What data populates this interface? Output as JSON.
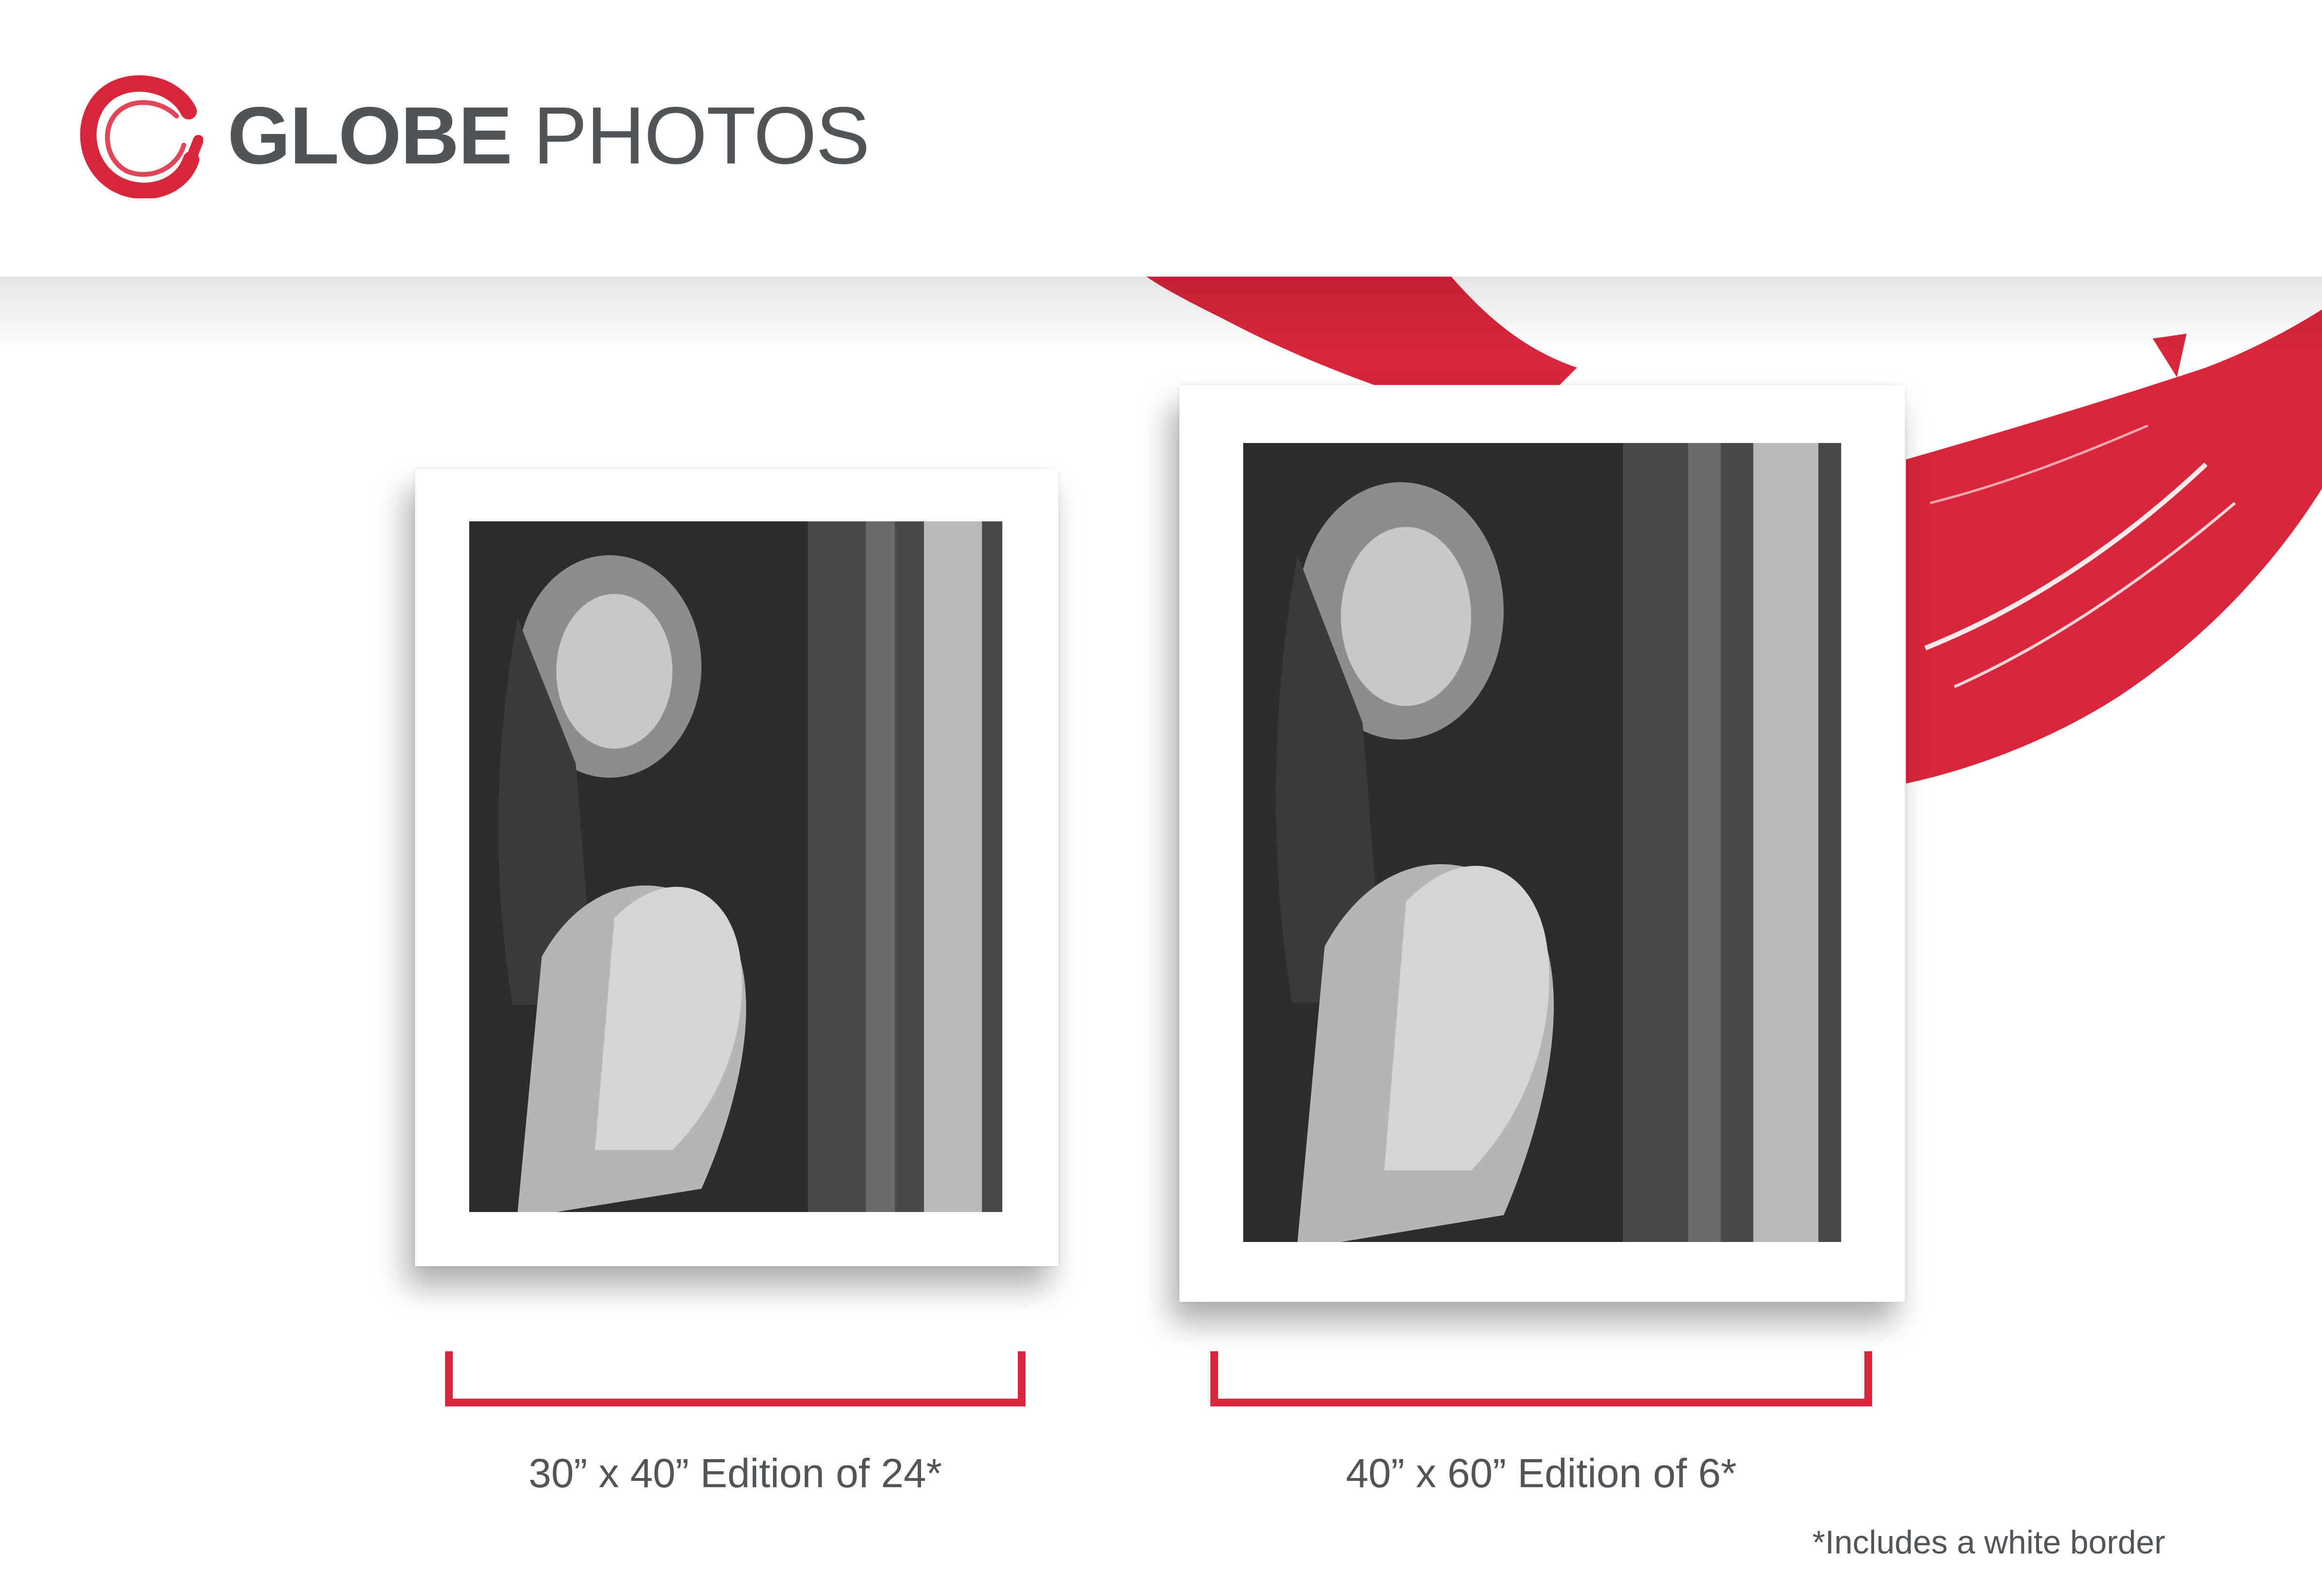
{
  "brand": {
    "name_bold": "GLOBE",
    "name_light": "PHOTOS",
    "accent_color": "#d9263a",
    "text_color": "#4f5559",
    "logo_icon": "brush-circle-icon"
  },
  "editions": [
    {
      "size": "30” x 40” Edition of 24*"
    },
    {
      "size": "40” x 60” Edition of 6*"
    }
  ],
  "footnote": "*Includes a white border"
}
